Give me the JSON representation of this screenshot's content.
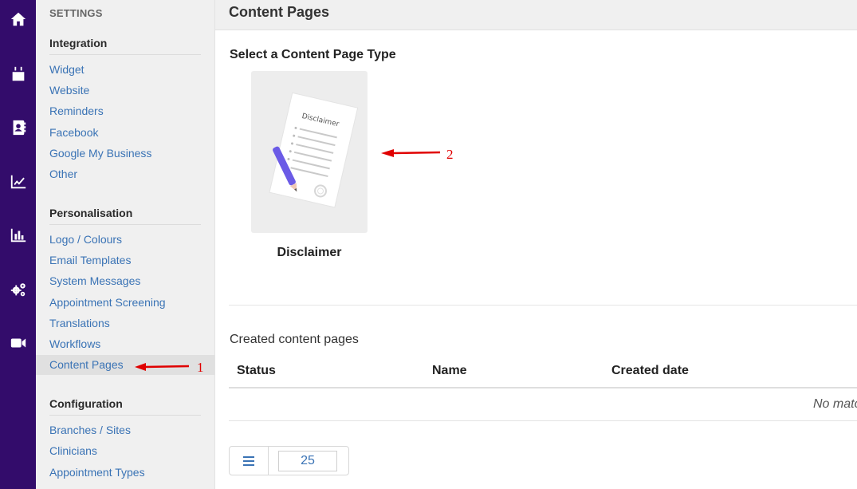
{
  "rail": {
    "icons": [
      "home-icon",
      "calendar-icon",
      "contacts-icon",
      "trend-chart-icon",
      "bar-chart-icon",
      "settings-gears-icon",
      "video-camera-icon"
    ]
  },
  "sidebar": {
    "title": "SETTINGS",
    "sections": [
      {
        "heading": "Integration",
        "items": [
          "Widget",
          "Website",
          "Reminders",
          "Facebook",
          "Google My Business",
          "Other"
        ]
      },
      {
        "heading": "Personalisation",
        "items": [
          "Logo / Colours",
          "Email Templates",
          "System Messages",
          "Appointment Screening",
          "Translations",
          "Workflows",
          "Content Pages"
        ]
      },
      {
        "heading": "Configuration",
        "items": [
          "Branches / Sites",
          "Clinicians",
          "Appointment Types"
        ]
      }
    ],
    "active_item": "Content Pages"
  },
  "main": {
    "title": "Content Pages",
    "select_title": "Select a Content Page Type",
    "card": {
      "label": "Disclaimer",
      "document_text": "Disclaimer"
    },
    "created_title": "Created content pages",
    "table": {
      "columns": [
        "Status",
        "Name",
        "Created date"
      ],
      "empty_text": "No matc"
    },
    "pager": {
      "page_size": "25"
    }
  },
  "annotations": {
    "first": "1",
    "second": "2",
    "color": "#e00000"
  },
  "colors": {
    "rail": "#330c6b",
    "link": "#3a73b5",
    "accent_pencil": "#6b5be6"
  }
}
